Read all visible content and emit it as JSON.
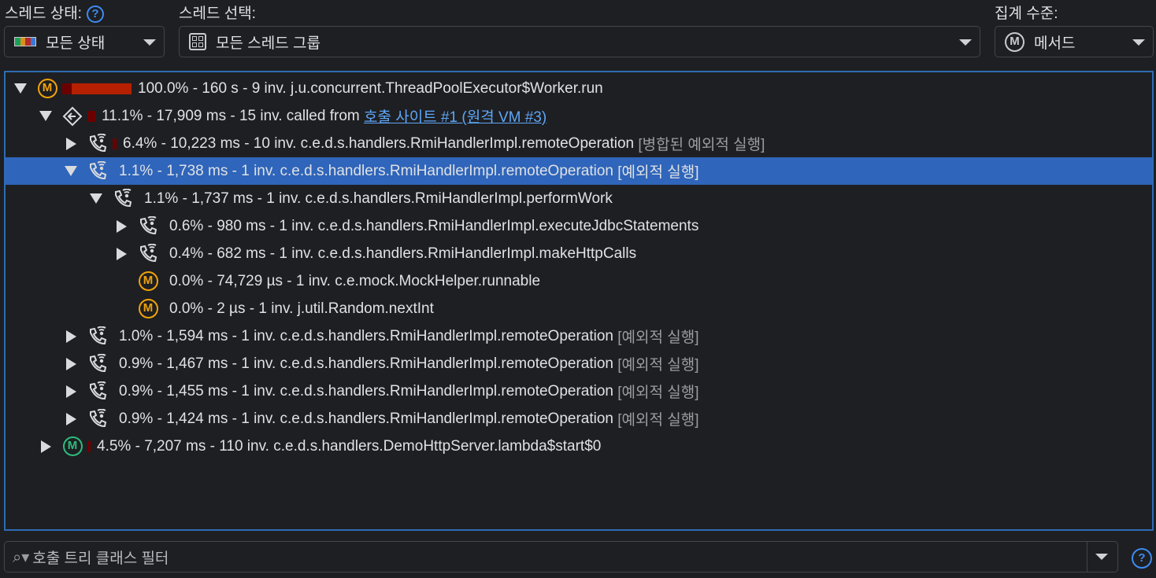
{
  "toolbar": {
    "thread_state_label": "스레드 상태:",
    "thread_state_value": "모든 상태",
    "thread_select_label": "스레드 선택:",
    "thread_select_value": "모든 스레드 그룹",
    "aggregation_label": "집계 수준:",
    "aggregation_value": "메서드",
    "help": "?"
  },
  "tree": {
    "rows": [
      {
        "level": 0,
        "toggle": "down",
        "icon": "method-icon",
        "bar": [
          12,
          76
        ],
        "text": "100.0% - 160 s - 9 inv. j.u.concurrent.ThreadPoolExecutor$Worker.run"
      },
      {
        "level": 1,
        "toggle": "down",
        "icon": "call-site-icon",
        "bar": [
          10,
          0
        ],
        "text": "11.1% - 17,909 ms - 15 inv. called from ",
        "link": "호출 사이트 #1 (원격 VM #3)"
      },
      {
        "level": 2,
        "toggle": "right",
        "icon": "remote-call-icon",
        "bar": [
          5,
          0
        ],
        "text": "6.4% - 10,223 ms - 10 inv. c.e.d.s.handlers.RmiHandlerImpl.remoteOperation ",
        "suffix": "[병합된 예외적 실행]"
      },
      {
        "level": 2,
        "toggle": "down",
        "icon": "remote-call-icon",
        "selected": true,
        "text": "1.1% - 1,738 ms - 1 inv. c.e.d.s.handlers.RmiHandlerImpl.remoteOperation ",
        "suffix": "[예외적 실행]"
      },
      {
        "level": 3,
        "toggle": "down",
        "icon": "remote-call-icon",
        "text": "1.1% - 1,737 ms - 1 inv. c.e.d.s.handlers.RmiHandlerImpl.performWork"
      },
      {
        "level": 4,
        "toggle": "right",
        "icon": "remote-call-icon",
        "text": "0.6% - 980 ms - 1 inv. c.e.d.s.handlers.RmiHandlerImpl.executeJdbcStatements"
      },
      {
        "level": 4,
        "toggle": "right",
        "icon": "remote-call-icon",
        "text": "0.4% - 682 ms - 1 inv. c.e.d.s.handlers.RmiHandlerImpl.makeHttpCalls"
      },
      {
        "level": 4,
        "toggle": "none",
        "icon": "method-icon",
        "text": "0.0% - 74,729 µs - 1 inv. c.e.mock.MockHelper.runnable"
      },
      {
        "level": 4,
        "toggle": "none",
        "icon": "method-icon",
        "text": "0.0% - 2 µs - 1 inv. j.util.Random.nextInt"
      },
      {
        "level": 2,
        "toggle": "right",
        "icon": "remote-call-icon",
        "text": "1.0% - 1,594 ms - 1 inv. c.e.d.s.handlers.RmiHandlerImpl.remoteOperation ",
        "suffix": "[예외적 실행]"
      },
      {
        "level": 2,
        "toggle": "right",
        "icon": "remote-call-icon",
        "text": "0.9% - 1,467 ms - 1 inv. c.e.d.s.handlers.RmiHandlerImpl.remoteOperation ",
        "suffix": "[예외적 실행]"
      },
      {
        "level": 2,
        "toggle": "right",
        "icon": "remote-call-icon",
        "text": "0.9% - 1,455 ms - 1 inv. c.e.d.s.handlers.RmiHandlerImpl.remoteOperation ",
        "suffix": "[예외적 실행]"
      },
      {
        "level": 2,
        "toggle": "right",
        "icon": "remote-call-icon",
        "text": "0.9% - 1,424 ms - 1 inv. c.e.d.s.handlers.RmiHandlerImpl.remoteOperation ",
        "suffix": "[예외적 실행]"
      },
      {
        "level": 1,
        "toggle": "right",
        "icon": "method-green-icon",
        "bar": [
          4,
          0
        ],
        "text": "4.5% - 7,207 ms - 110 inv. c.e.d.s.handlers.DemoHttpServer.lambda$start$0"
      }
    ]
  },
  "filter": {
    "placeholder": "호출 트리 클래스 필터"
  },
  "colors": {
    "accent": "#2f65ba",
    "bar_dark": "#6b0000",
    "bar_red": "#b52000",
    "method": "#f0a30a",
    "method_green": "#2bbd7e",
    "link": "#5ea6f7"
  }
}
